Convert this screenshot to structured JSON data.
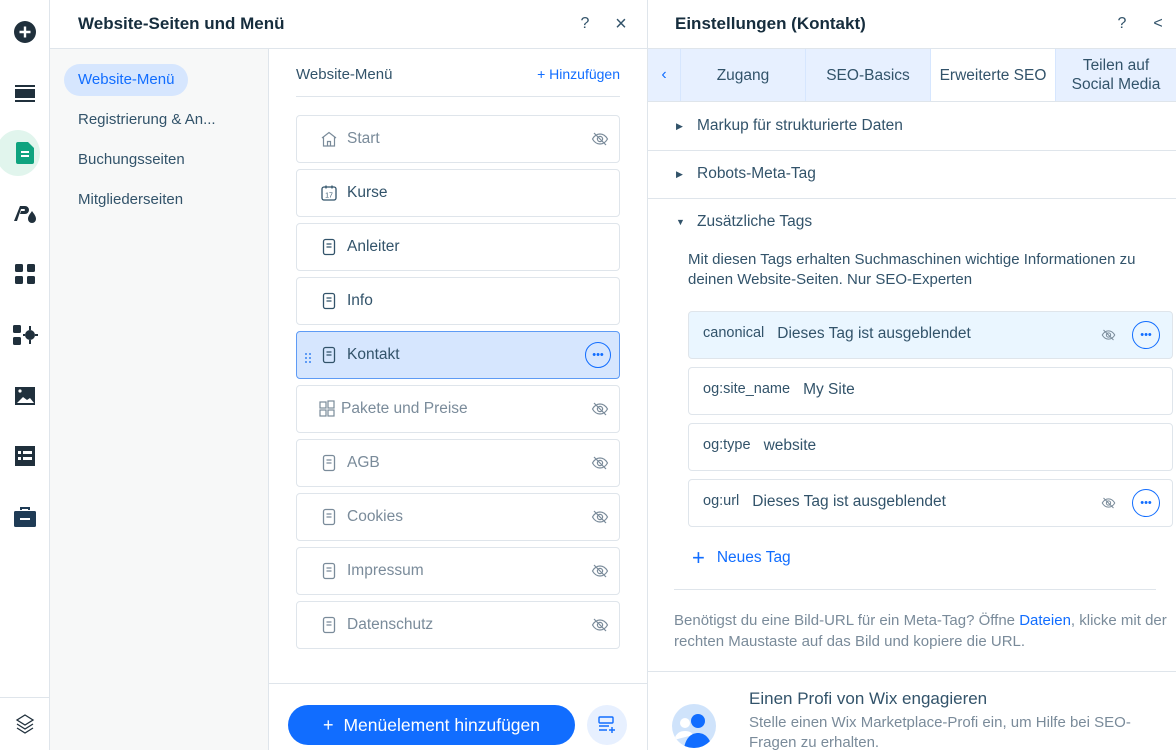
{
  "rail": {
    "items": [
      {
        "icon": "add-circle-icon"
      },
      {
        "icon": "sections-icon"
      },
      {
        "icon": "pages-icon",
        "active": true
      },
      {
        "icon": "design-theme-icon"
      },
      {
        "icon": "apps-grid-icon"
      },
      {
        "icon": "business-apps-icon"
      },
      {
        "icon": "media-icon"
      },
      {
        "icon": "cms-table-icon"
      },
      {
        "icon": "portfolio-briefcase-icon"
      }
    ],
    "bottom_icon": "layers-icon"
  },
  "pages_panel": {
    "title": "Website-Seiten und Menü",
    "help": "?",
    "close": "×",
    "nav": [
      {
        "label": "Website-Menü",
        "active": true
      },
      {
        "label": "Registrierung & An..."
      },
      {
        "label": "Buchungsseiten"
      },
      {
        "label": "Mitgliederseiten"
      }
    ],
    "menu": {
      "title": "Website-Menü",
      "add_label": "Hinzufügen",
      "items": [
        {
          "label": "Start",
          "icon": "home-icon",
          "hidden": true
        },
        {
          "label": "Kurse",
          "icon": "calendar-icon",
          "hidden": false
        },
        {
          "label": "Anleiter",
          "icon": "page-icon",
          "hidden": false
        },
        {
          "label": "Info",
          "icon": "page-icon",
          "hidden": false
        },
        {
          "label": "Kontakt",
          "icon": "page-icon",
          "hidden": false,
          "selected": true
        },
        {
          "label": "Pakete und Preise",
          "icon": "pricing-plans-icon",
          "hidden": true
        },
        {
          "label": "AGB",
          "icon": "page-icon",
          "hidden": true
        },
        {
          "label": "Cookies",
          "icon": "page-icon",
          "hidden": true
        },
        {
          "label": "Impressum",
          "icon": "page-icon",
          "hidden": true
        },
        {
          "label": "Datenschutz",
          "icon": "page-icon",
          "hidden": true
        }
      ]
    },
    "add_button_label": "Menüelement hinzufügen"
  },
  "settings": {
    "title": "Einstellungen (Kontakt)",
    "help": "?",
    "collapse": "<",
    "tabs": [
      {
        "label": "Zugang"
      },
      {
        "label": "SEO-Basics"
      },
      {
        "label": "Erweiterte SEO",
        "active": true
      },
      {
        "label": "Teilen auf Social Media"
      }
    ],
    "sections": [
      {
        "label": "Markup für strukturierte Daten",
        "expanded": false
      },
      {
        "label": "Robots-Meta-Tag",
        "expanded": false
      },
      {
        "label": "Zusätzliche Tags",
        "expanded": true
      }
    ],
    "description": "Mit diesen Tags erhalten Suchmaschinen wichtige Informationen zu deinen Website-Seiten. Nur SEO-Experten",
    "tags": [
      {
        "key": "canonical",
        "value": "Dieses Tag ist ausgeblendet",
        "hidden": true
      },
      {
        "key": "og:site_name",
        "value": "My Site",
        "hidden": false
      },
      {
        "key": "og:type",
        "value": "website",
        "hidden": false
      },
      {
        "key": "og:url",
        "value": "Dieses Tag ist ausgeblendet",
        "hidden": true
      }
    ],
    "new_tag_label": "Neues Tag",
    "hint_before": "Benötigst du eine Bild-URL für ein Meta-Tag? Öffne ",
    "hint_link": "Dateien",
    "hint_after": ", klicke mit der rechten Maustaste auf das Bild und kopiere die URL.",
    "pro": {
      "title": "Einen Profi von Wix engagieren",
      "description": "Stelle einen Wix Marketplace-Profi ein, um Hilfe bei SEO-Fragen zu erhalten."
    }
  },
  "colors": {
    "accent": "#116dff",
    "selected_bg": "#d6e6fe",
    "active_rail": "#0fa37f"
  }
}
